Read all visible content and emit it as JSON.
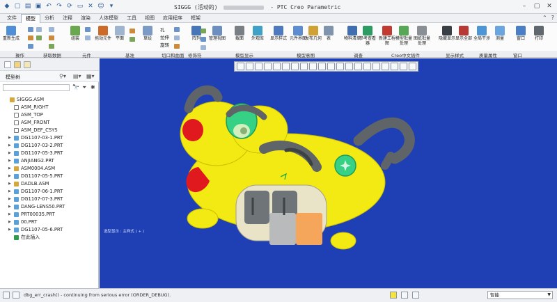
{
  "titlebar": {
    "title_prefix": "SIGGG (活动的)",
    "title_suffix": "- PTC Creo Parametric"
  },
  "menu": {
    "tabs": [
      "文件",
      "模型",
      "分析",
      "注释",
      "渲染",
      "人体模型",
      "工具",
      "视图",
      "应用程序",
      "框架"
    ],
    "active": "模型",
    "right_icons": [
      "help-icon"
    ]
  },
  "ribbon": {
    "buttons": [
      {
        "label": "重新生成",
        "icon": "regenerate-icon"
      },
      {
        "label": "组装",
        "icon": "assemble-icon"
      },
      {
        "label": "拖动元件",
        "icon": "drag-icon"
      },
      {
        "label": "平面",
        "icon": "plane-icon"
      },
      {
        "label": "草绘",
        "icon": "sketch-icon"
      },
      {
        "label": "阵列",
        "icon": "pattern-icon"
      },
      {
        "label": "管理视图",
        "icon": "view-manager-icon"
      },
      {
        "label": "截面",
        "icon": "section-icon"
      },
      {
        "label": "外观库",
        "icon": "appearance-icon"
      },
      {
        "label": "显示样式",
        "icon": "display-style-icon"
      },
      {
        "label": "元件界面",
        "icon": "component-interface-icon"
      },
      {
        "label": "发布几何",
        "icon": "publish-geometry-icon"
      },
      {
        "label": "表",
        "icon": "table-icon"
      },
      {
        "label": "物料清单",
        "icon": "bom-icon"
      },
      {
        "label": "参考查看器",
        "icon": "ref-viewer-icon"
      },
      {
        "label": "新建工程图",
        "icon": "new-drawing-icon"
      },
      {
        "label": "模型批量处理",
        "icon": "batch-icon"
      },
      {
        "label": "图纸批量处理",
        "icon": "drawing-batch-icon"
      },
      {
        "label": "隐藏显示",
        "icon": "hide-show-icon"
      },
      {
        "label": "显示全部",
        "icon": "show-all-icon"
      },
      {
        "label": "全局干涉",
        "icon": "interference-icon"
      },
      {
        "label": "测量",
        "icon": "measure-icon"
      },
      {
        "label": "窗口",
        "icon": "window-icon"
      },
      {
        "label": "打印",
        "icon": "print-icon"
      }
    ],
    "small_items": [
      "孔",
      "拉伸",
      "旋转"
    ],
    "groups": [
      "操作",
      "获取数据",
      "元件",
      "基准",
      "切口和曲面",
      "修饰符",
      "模型显示",
      "模型意图",
      "调查",
      "Creo中文插件",
      "显示样式",
      "质量属性",
      "窗口"
    ]
  },
  "left_panel": {
    "title": "模型树",
    "tree": [
      {
        "label": "SIGGG.ASM",
        "icon": "assembly-icon",
        "level": 0,
        "expandable": false
      },
      {
        "label": "ASM_RIGHT",
        "icon": "datum-plane-icon",
        "level": 1,
        "expandable": false
      },
      {
        "label": "ASM_TOP",
        "icon": "datum-plane-icon",
        "level": 1,
        "expandable": false
      },
      {
        "label": "ASM_FRONT",
        "icon": "datum-plane-icon",
        "level": 1,
        "expandable": false
      },
      {
        "label": "ASM_DEF_CSYS",
        "icon": "csys-icon",
        "level": 1,
        "expandable": false
      },
      {
        "label": "DG1107-03-1.PRT",
        "icon": "part-icon",
        "level": 1,
        "expandable": true
      },
      {
        "label": "DG1107-03-2.PRT",
        "icon": "part-icon",
        "level": 1,
        "expandable": true
      },
      {
        "label": "DG1107-05-3.PRT",
        "icon": "part-icon",
        "level": 1,
        "expandable": true
      },
      {
        "label": "ANJIANG2.PRT",
        "icon": "part-icon",
        "level": 1,
        "expandable": true
      },
      {
        "label": "ASM0004.ASM",
        "icon": "assembly-icon",
        "level": 1,
        "expandable": true
      },
      {
        "label": "DG1107-05-5.PRT",
        "icon": "part-icon",
        "level": 1,
        "expandable": true
      },
      {
        "label": "DADLB.ASM",
        "icon": "assembly-icon",
        "level": 1,
        "expandable": true
      },
      {
        "label": "DG1107-06-1.PRT",
        "icon": "part-icon",
        "level": 1,
        "expandable": true
      },
      {
        "label": "DG1107-07-3.PRT",
        "icon": "part-icon",
        "level": 1,
        "expandable": true
      },
      {
        "label": "DANG-LENS50.PRT",
        "icon": "part-icon",
        "level": 1,
        "expandable": true
      },
      {
        "label": "PRT00035.PRT",
        "icon": "part-icon",
        "level": 1,
        "expandable": true
      },
      {
        "label": "00.PRT",
        "icon": "part-icon",
        "level": 1,
        "expandable": true
      },
      {
        "label": "DG1107-05-6.PRT",
        "icon": "part-icon",
        "level": 1,
        "expandable": true
      },
      {
        "label": "在此插入",
        "icon": "insert-here-icon",
        "level": 1,
        "expandable": false
      }
    ]
  },
  "viewport": {
    "background": "#1f3fb5",
    "status_text": "选型显示 : 主样式 ( + )"
  },
  "statusbar": {
    "message": "dbg_err_crash() - continuing from serious error (ORDER_DEBUG).",
    "filter_value": "智能"
  },
  "colors": {
    "model_yellow": "#f2ea12",
    "model_red": "#e0191f",
    "model_gray": "#6f7478",
    "model_green": "#36d184",
    "model_orange": "#f6a65a"
  }
}
